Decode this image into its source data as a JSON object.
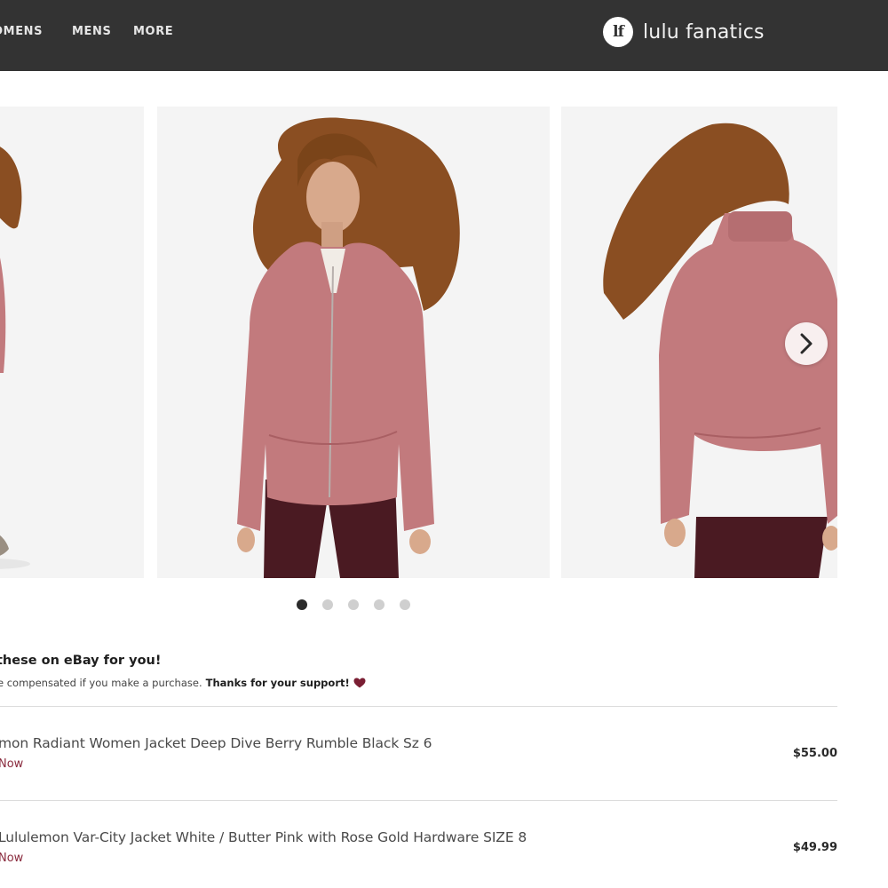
{
  "header": {
    "nav": [
      "OMENS",
      "MENS",
      "MORE"
    ],
    "logo_mark": "lf",
    "logo_text": "lulu fanatics"
  },
  "carousel": {
    "slides": [
      {
        "alt": "Woman wearing pink zip jacket, side view"
      },
      {
        "alt": "Woman wearing rosewood zip-up jacket with burgundy tights, front view"
      },
      {
        "alt": "Woman wearing rosewood zip-up jacket, back view"
      }
    ],
    "dot_count": 5,
    "active_dot": 0,
    "next_icon": "chevron-right-icon"
  },
  "ebay": {
    "heading": "these on eBay for you!",
    "note_prefix": "e compensated if you make a purchase.",
    "note_bold": "Thanks for your support!",
    "heart_color": "#7a1e33",
    "listings": [
      {
        "title": "mon Radiant Women Jacket Deep Dive Berry Rumble Black Sz 6",
        "cta": "Now",
        "price": "$55.00"
      },
      {
        "title": "Lululemon Var-City Jacket White / Butter Pink with Rose Gold Hardware SIZE 8",
        "cta": "Now",
        "price": "$49.99"
      }
    ]
  },
  "colors": {
    "header_bg": "#333333",
    "jacket": "#c27a7d",
    "tights": "#4a1a22",
    "hair": "#8a4e22",
    "link": "#8a2b3e"
  }
}
